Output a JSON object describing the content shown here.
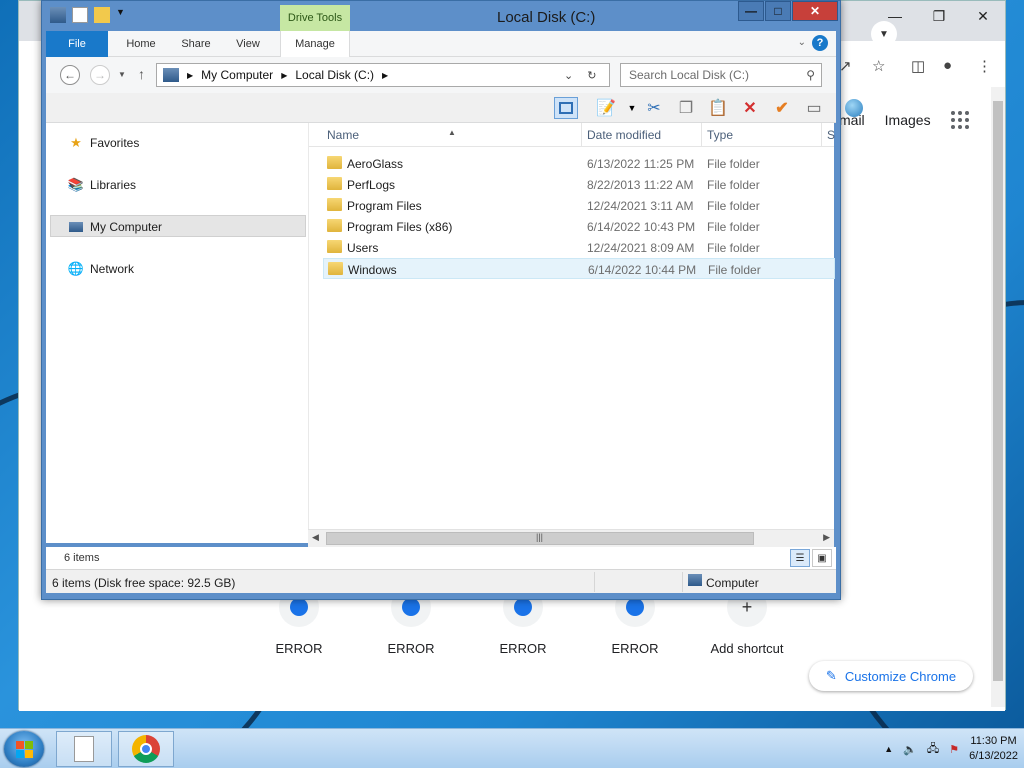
{
  "explorer": {
    "title": "Local Disk (C:)",
    "contextual_tab": "Drive Tools",
    "ribbon_tabs": [
      "File",
      "Home",
      "Share",
      "View",
      "Manage"
    ],
    "help_label": "?",
    "breadcrumb": [
      "My Computer",
      "Local Disk (C:)"
    ],
    "search_placeholder": "Search Local Disk (C:)",
    "columns": [
      "Name",
      "Date modified",
      "Type",
      "S"
    ],
    "nav": {
      "favorites": "Favorites",
      "libraries": "Libraries",
      "my_computer": "My Computer",
      "network": "Network"
    },
    "files": [
      {
        "name": "AeroGlass",
        "date": "6/13/2022 11:25 PM",
        "type": "File folder"
      },
      {
        "name": "PerfLogs",
        "date": "8/22/2013 11:22 AM",
        "type": "File folder"
      },
      {
        "name": "Program Files",
        "date": "12/24/2021 3:11 AM",
        "type": "File folder"
      },
      {
        "name": "Program Files (x86)",
        "date": "6/14/2022 10:43 PM",
        "type": "File folder"
      },
      {
        "name": "Users",
        "date": "12/24/2021 8:09 AM",
        "type": "File folder"
      },
      {
        "name": "Windows",
        "date": "6/14/2022 10:44 PM",
        "type": "File folder"
      }
    ],
    "selected_index": 5,
    "item_count": "6 items",
    "status_left": "6 items (Disk free space: 92.5 GB)",
    "status_right": "Computer"
  },
  "chrome": {
    "links": [
      "mail",
      "Images"
    ],
    "shortcuts": [
      "ERROR",
      "ERROR",
      "ERROR",
      "ERROR",
      "Add shortcut"
    ],
    "customize_label": "Customize Chrome"
  },
  "taskbar": {
    "time": "11:30 PM",
    "date": "6/13/2022"
  },
  "colors": {
    "file_tab": "#1979ca",
    "drive_tools": "#c6e7a3",
    "close_button": "#c7403a",
    "selection": "#e5f3fb",
    "chrome_accent": "#1a73e8"
  }
}
